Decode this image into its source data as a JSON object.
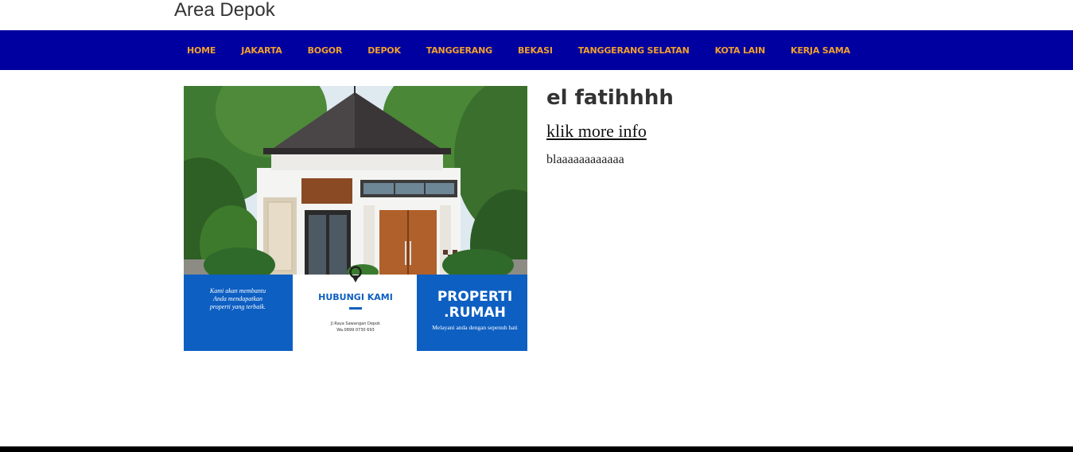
{
  "header": {
    "site_title": "Area Depok"
  },
  "nav": {
    "items": [
      {
        "label": "HOME"
      },
      {
        "label": "JAKARTA"
      },
      {
        "label": "BOGOR"
      },
      {
        "label": "DEPOK"
      },
      {
        "label": "TANGGERANG"
      },
      {
        "label": "BEKASI"
      },
      {
        "label": "TANGGERANG SELATAN"
      },
      {
        "label": "KOTA LAIN"
      },
      {
        "label": "KERJA SAMA"
      }
    ]
  },
  "post": {
    "title": "el fatihhhh",
    "more_link": "klik more info",
    "excerpt": "blaaaaaaaaaaaa",
    "image": {
      "left_text": [
        "Kami akan membantu",
        "Anda mendapatkan",
        "properti yang terbaik."
      ],
      "center_heading": "HUBUNGI KAMI",
      "center_small": [
        "Jl.Raya Sawangan Depok",
        "Wa.0899 0730 693"
      ],
      "right_heading": [
        "PROPERTI",
        ".RUMAH"
      ],
      "right_small": "Melayani anda dengan sepenuh hati"
    }
  },
  "colors": {
    "nav_bg": "#0000a0",
    "nav_text": "#f0a030",
    "banner_blue": "#0d5fc2"
  }
}
